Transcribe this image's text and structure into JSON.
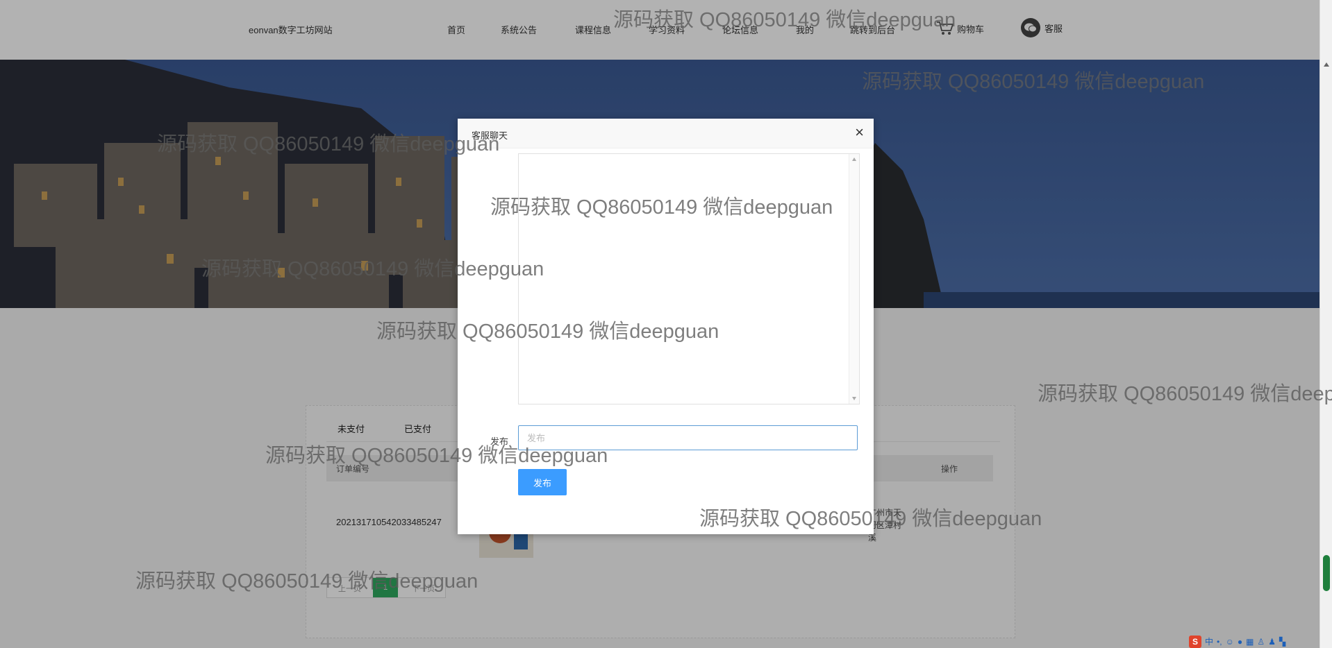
{
  "header": {
    "brand": "eonvan数字工坊网站",
    "nav": [
      "首页",
      "系统公告",
      "课程信息",
      "学习资料",
      "论坛信息",
      "我的",
      "跳转到后台"
    ],
    "cart_label": "购物车",
    "service_label": "客服"
  },
  "orders": {
    "tabs": [
      "未支付",
      "已支付"
    ],
    "columns": {
      "order_no": "订单编号",
      "action": "操作"
    },
    "row": {
      "order_no": "20213171054203348524​7",
      "address_line1": "广州市天",
      "address_line2": "河区潭村",
      "address_line3": "溪"
    },
    "pager": {
      "prev": "上一页",
      "current": "1",
      "next": "下一页"
    }
  },
  "dialog": {
    "title": "客服聊天",
    "close_symbol": "×",
    "post_label": "发布",
    "input_placeholder": "发布",
    "input_value": "",
    "button_label": "发布"
  },
  "watermark_text": "源码获取 QQ86050149 微信deepguan",
  "ime": {
    "logo": "S",
    "label": "中"
  }
}
